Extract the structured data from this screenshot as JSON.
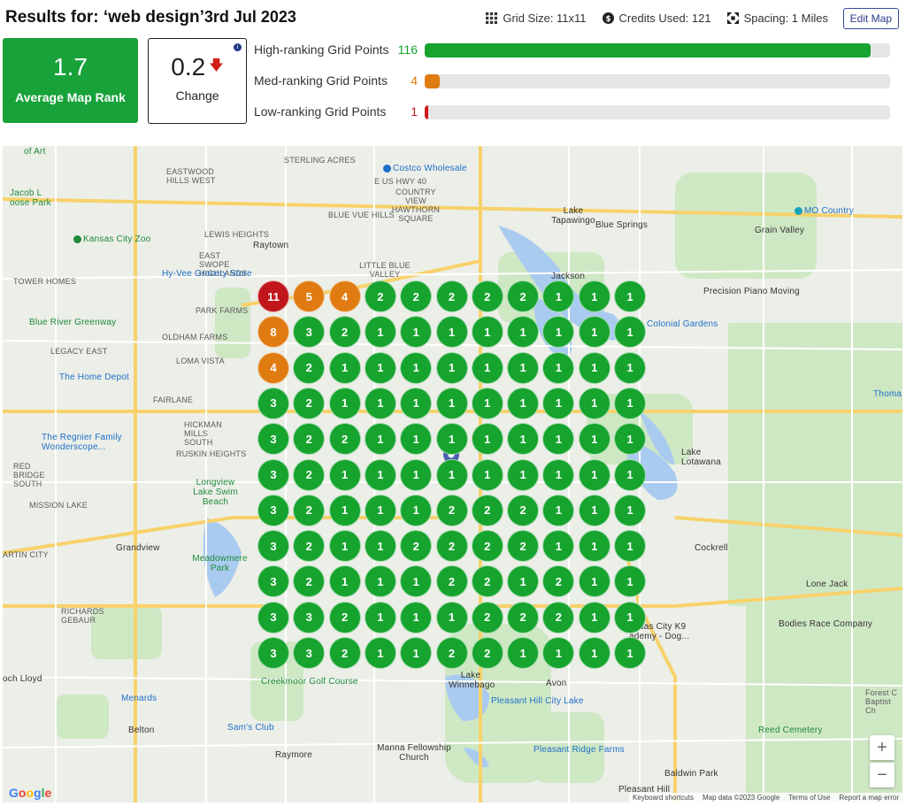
{
  "header": {
    "title": "Results for: ‘web design’",
    "date": "3rd Jul 2023",
    "grid_size": "Grid Size: 11x11",
    "credits": "Credits Used: 121",
    "spacing": "Spacing: 1 Miles",
    "edit_button": "Edit Map"
  },
  "stats": {
    "average_value": "1.7",
    "average_label": "Average Map Rank",
    "change_value": "0.2",
    "change_label": "Change"
  },
  "ranking": [
    {
      "label": "High-ranking Grid Points",
      "count": "116",
      "fraction": 0.959,
      "color": "#16a32e"
    },
    {
      "label": "Med-ranking Grid Points",
      "count": "4",
      "fraction": 0.033,
      "color": "#e07b12"
    },
    {
      "label": "Low-ranking Grid Points",
      "count": "1",
      "fraction": 0.008,
      "color": "#cc1a1a"
    }
  ],
  "grid": [
    [
      11,
      5,
      4,
      2,
      2,
      2,
      2,
      2,
      1,
      1,
      1
    ],
    [
      8,
      3,
      2,
      1,
      1,
      1,
      1,
      1,
      1,
      1,
      1
    ],
    [
      4,
      2,
      1,
      1,
      1,
      1,
      1,
      1,
      1,
      1,
      1
    ],
    [
      3,
      2,
      1,
      1,
      1,
      1,
      1,
      1,
      1,
      1,
      1
    ],
    [
      3,
      2,
      2,
      1,
      1,
      1,
      1,
      1,
      1,
      1,
      1
    ],
    [
      3,
      2,
      1,
      1,
      1,
      1,
      1,
      1,
      1,
      1,
      1
    ],
    [
      3,
      2,
      1,
      1,
      1,
      2,
      2,
      2,
      1,
      1,
      1
    ],
    [
      3,
      2,
      1,
      1,
      2,
      2,
      2,
      2,
      1,
      1,
      1
    ],
    [
      3,
      2,
      1,
      1,
      1,
      2,
      2,
      1,
      2,
      1,
      1
    ],
    [
      3,
      3,
      2,
      1,
      1,
      1,
      2,
      2,
      2,
      1,
      1
    ],
    [
      3,
      3,
      2,
      1,
      1,
      2,
      2,
      1,
      1,
      1,
      1
    ]
  ],
  "grid_colors": {
    "high": "#16a32e",
    "med": "#e07b12",
    "low": "#c0161c"
  },
  "map_labels": {
    "sterling_acres": "STERLING ACRES",
    "costco": "Costco Wholesale",
    "eastwood": "EASTWOOD HILLS WEST",
    "us_hwy": "E US HWY 40",
    "country_view": "COUNTRY VIEW HAWTHORN SQUARE",
    "lake_tapawingo": "Lake Tapawingo",
    "blue_springs": "Blue Springs",
    "mo_country": "MO Country",
    "grain_valley": "Grain Valley",
    "kc_zoo": "Kansas City Zoo",
    "lewis_heights": "LEWIS HEIGHTS",
    "raytown": "Raytown",
    "blue_vue": "BLUE VUE HILLS",
    "east_swope": "EAST SWOPE HIGHLANDS",
    "little_blue": "LITTLE BLUE VALLEY",
    "hyvee": "Hy-Vee Grocery Store",
    "tower_homes": "TOWER HOMES",
    "jackson": "Jackson",
    "precision_piano": "Precision Piano Moving",
    "park_farms": "PARK FARMS",
    "blue_river": "Blue River Greenway",
    "oldham_farms": "OLDHAM FARMS",
    "colonial_gardens": "Colonial Gardens",
    "legacy_east": "LEGACY EAST",
    "loma_vista": "LOMA VISTA",
    "home_depot": "The Home Depot",
    "fairlane": "FAIRLANE",
    "thoma": "Thoma",
    "hickman_mills": "HICKMAN MILLS SOUTH",
    "regnier": "The Regnier Family Wonderscope...",
    "ruskin_heights": "RUSKIN HEIGHTS",
    "lake_lotawana": "Lake Lotawana",
    "red_bridge": "RED BRIDGE SOUTH",
    "longview": "Longview Lake Swim Beach",
    "mission_lake": "MISSION LAKE",
    "grandview": "Grandview",
    "meadowmere": "Meadowmere Park",
    "cockrell": "Cockrell",
    "martin_city": "ARTIN CITY",
    "lone_jack": "Lone Jack",
    "richards": "RICHARDS GEBAUR",
    "bodies_race": "Bodies Race Company",
    "kc_k9": "ansas City K9 ademy - Dog...",
    "creekmoor": "Creekmoor Golf Course",
    "lake_winnebago": "Lake Winnebago",
    "avon": "Avon",
    "loch_lloyd": "och Lloyd",
    "menards": "Menards",
    "pleasant_hill_lake": "Pleasant Hill City Lake",
    "forest": "Forest C Baptist Ch",
    "belton": "Belton",
    "sams": "Sam's Club",
    "reed_cemetery": "Reed Cemetery",
    "manna": "Manna Fellowship Church",
    "pleasant_ridge": "Pleasant Ridge Farms",
    "raymore": "Raymore",
    "baldwin_park": "Baldwin Park",
    "pleasant_hill": "Pleasant Hill",
    "jacob": "Jacob L oose Park",
    "of_art": "of Art"
  },
  "attribution": {
    "google": "Google",
    "keyboard": "Keyboard shortcuts",
    "map_data": "Map data ©2023 Google",
    "terms": "Terms of Use",
    "report": "Report a map error"
  },
  "zoom": {
    "in": "+",
    "out": "−"
  }
}
